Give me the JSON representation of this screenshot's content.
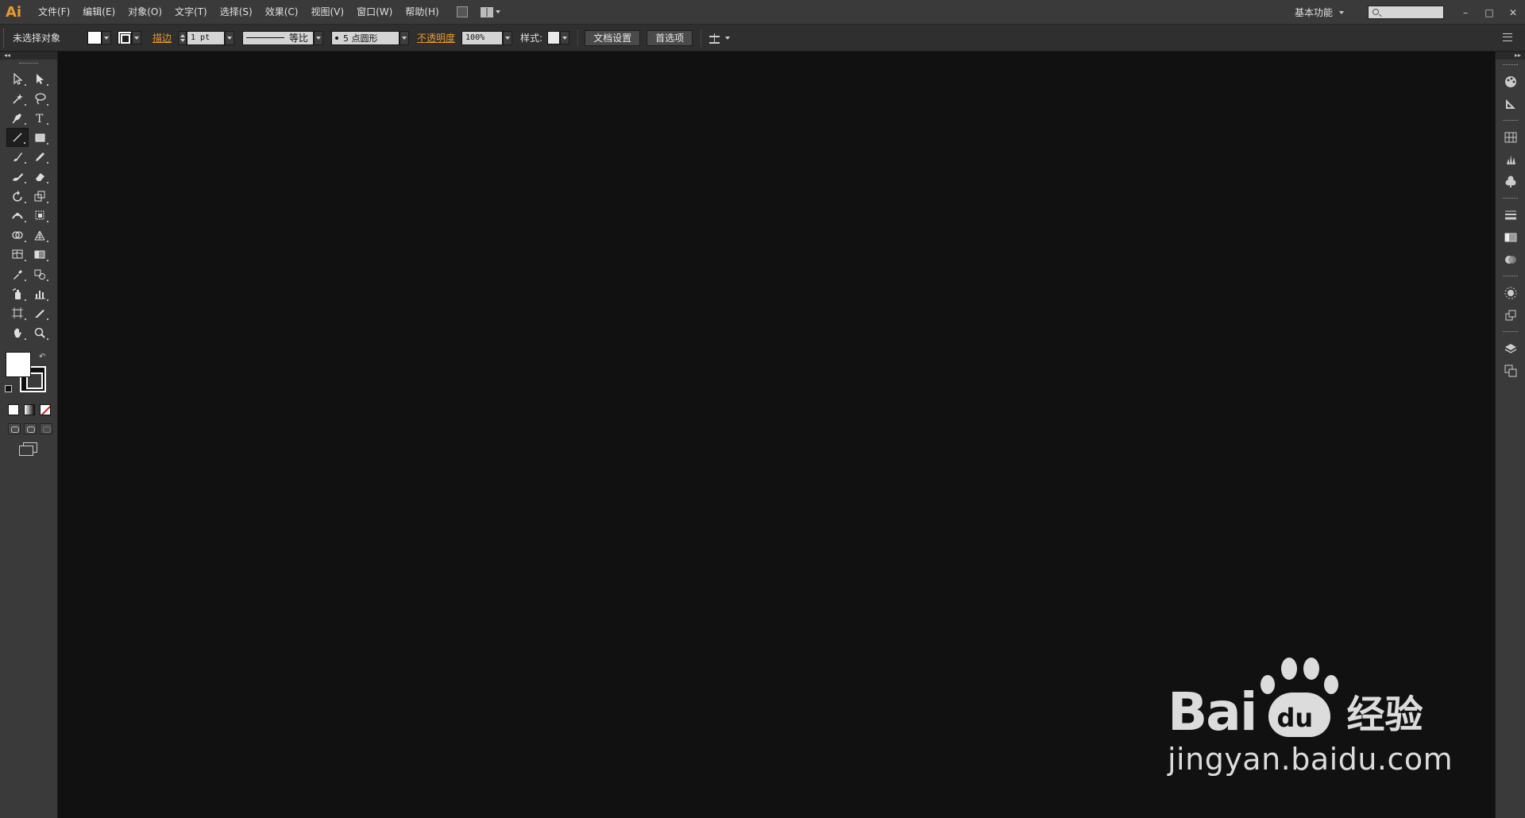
{
  "app": {
    "logo": "Ai"
  },
  "menu": [
    "文件(F)",
    "编辑(E)",
    "对象(O)",
    "文字(T)",
    "选择(S)",
    "效果(C)",
    "视图(V)",
    "窗口(W)",
    "帮助(H)"
  ],
  "menubar_right": {
    "workspace": "基本功能",
    "window_buttons": [
      "–",
      "□",
      "✕"
    ]
  },
  "controlbar": {
    "selection_status": "未选择对象",
    "stroke_label": "描边",
    "stroke_weight": "1 pt",
    "variable_width": "等比",
    "brush": "5 点圆形",
    "opacity_label": "不透明度",
    "opacity_value": "100%",
    "style_label": "样式:",
    "document_setup": "文档设置",
    "preferences": "首选项"
  },
  "colors": {
    "accent": "#e69a2f",
    "canvas": "#111111",
    "panel": "#3a3a3a",
    "fill": "#ffffff",
    "stroke": "#111111"
  },
  "tools": [
    [
      "selection-tool-icon",
      "direct-selection-tool-icon"
    ],
    [
      "magic-wand-tool-icon",
      "lasso-tool-icon"
    ],
    [
      "pen-tool-icon",
      "type-tool-icon"
    ],
    [
      "line-segment-tool-icon",
      "rectangle-tool-icon"
    ],
    [
      "paintbrush-tool-icon",
      "pencil-tool-icon"
    ],
    [
      "blob-brush-tool-icon",
      "eraser-tool-icon"
    ],
    [
      "rotate-tool-icon",
      "scale-tool-icon"
    ],
    [
      "width-tool-icon",
      "free-transform-tool-icon"
    ],
    [
      "shape-builder-tool-icon",
      "perspective-grid-tool-icon"
    ],
    [
      "mesh-tool-icon",
      "gradient-tool-icon"
    ],
    [
      "eyedropper-tool-icon",
      "blend-tool-icon"
    ],
    [
      "symbol-sprayer-tool-icon",
      "column-graph-tool-icon"
    ],
    [
      "artboard-tool-icon",
      "slice-tool-icon"
    ],
    [
      "hand-tool-icon",
      "zoom-tool-icon"
    ]
  ],
  "dock_icons": [
    [
      "color-icon",
      "color-guide-icon"
    ],
    [
      "swatches-icon",
      "brushes-icon",
      "symbols-icon"
    ],
    [
      "stroke-icon",
      "gradient-icon",
      "transparency-icon"
    ],
    [
      "appearance-icon",
      "graphic-styles-icon"
    ],
    [
      "layers-icon",
      "artboards-icon"
    ]
  ],
  "watermark": {
    "bai": "Bai",
    "du": "du",
    "jingyan": "经验",
    "url": "jingyan.baidu.com"
  }
}
